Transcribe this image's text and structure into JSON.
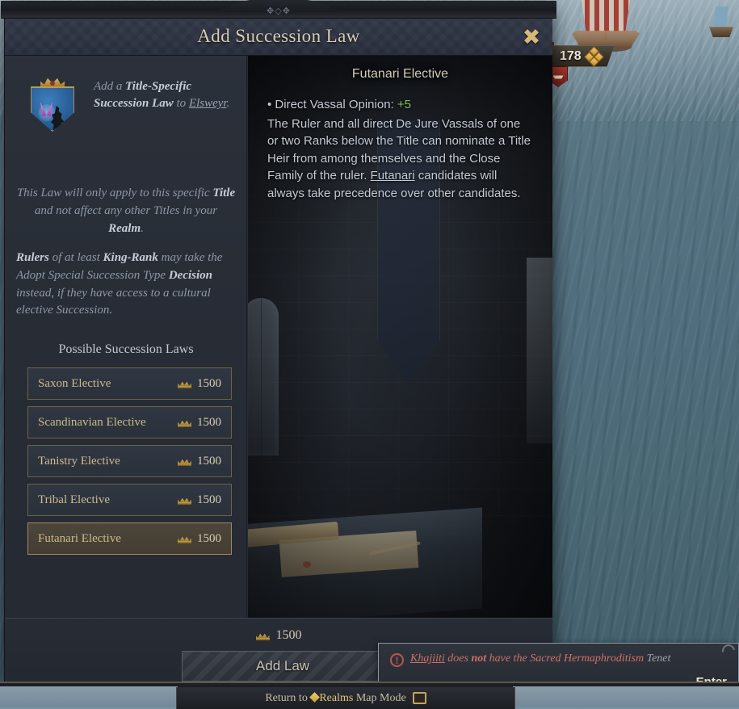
{
  "window": {
    "title": "Add Succession Law",
    "close_icon": "close-icon"
  },
  "map": {
    "unit_counter": {
      "count": "178",
      "icon": "levy-diamonds-icon",
      "badge_icon": "boat-icon"
    }
  },
  "left_panel": {
    "coat_of_arms_icon": "coat-of-arms-elsweyr",
    "intro": {
      "lead": "Add a ",
      "bold1": "Title-Specific Succession Law",
      "mid": " to ",
      "link": "Elsweyr",
      "tail": "."
    },
    "paragraph_2": {
      "p1": "This Law will only apply to this specific ",
      "b1": "Title",
      "p2": " and not affect any other Titles in your ",
      "b2": "Realm",
      "p3": "."
    },
    "paragraph_3": {
      "b1": "Rulers",
      "p1": " of at least ",
      "b2": "King-Rank",
      "p2": " may take the Adopt Special Succession Type ",
      "b3": "Decision",
      "p3": " instead, if they have access to a cultural elective Succession."
    },
    "laws_heading": "Possible Succession Laws",
    "laws": [
      {
        "name": "Saxon Elective",
        "cost": "1500",
        "cost_icon": "prestige-crown-icon",
        "selected": false
      },
      {
        "name": "Scandinavian Elective",
        "cost": "1500",
        "cost_icon": "prestige-crown-icon",
        "selected": false
      },
      {
        "name": "Tanistry Elective",
        "cost": "1500",
        "cost_icon": "prestige-crown-icon",
        "selected": false
      },
      {
        "name": "Tribal Elective",
        "cost": "1500",
        "cost_icon": "prestige-crown-icon",
        "selected": false
      },
      {
        "name": "Futanari Elective",
        "cost": "1500",
        "cost_icon": "prestige-crown-icon",
        "selected": true
      }
    ]
  },
  "detail_panel": {
    "title": "Futanari Elective",
    "modifier_line": "• Direct Vassal Opinion: ",
    "modifier_value": "+5",
    "description_1": "The Ruler and all direct De Jure Vassals of one or two Ranks below the Title can nominate a Title Heir from among themselves and the Close Family of the ruler. ",
    "description_link": "Futanari",
    "description_2": " candidates will always take precedence over other candidates."
  },
  "footer": {
    "total_cost": "1500",
    "total_cost_icon": "prestige-crown-icon",
    "add_law_label": "Add Law",
    "add_law_enabled": false
  },
  "error_tooltip": {
    "alert_icon": "alert-exclamation-icon",
    "link": "Khajiiti",
    "text_1": " does ",
    "bold": "not",
    "text_2": " have the Sacred Hermaphroditism ",
    "tenet_word": "Tenet",
    "enter_hint": "Enter"
  },
  "bottom_bar": {
    "return_prefix": "Return to ",
    "return_highlight": "Realms",
    "return_suffix": " Map Mode",
    "book_icon": "book-icon"
  },
  "colors": {
    "accent_gold": "#d7b77a",
    "law_name": "#cdb98d",
    "positive": "#7ec264",
    "error_red": "#cf7068",
    "panel_bg": "#262b33"
  }
}
